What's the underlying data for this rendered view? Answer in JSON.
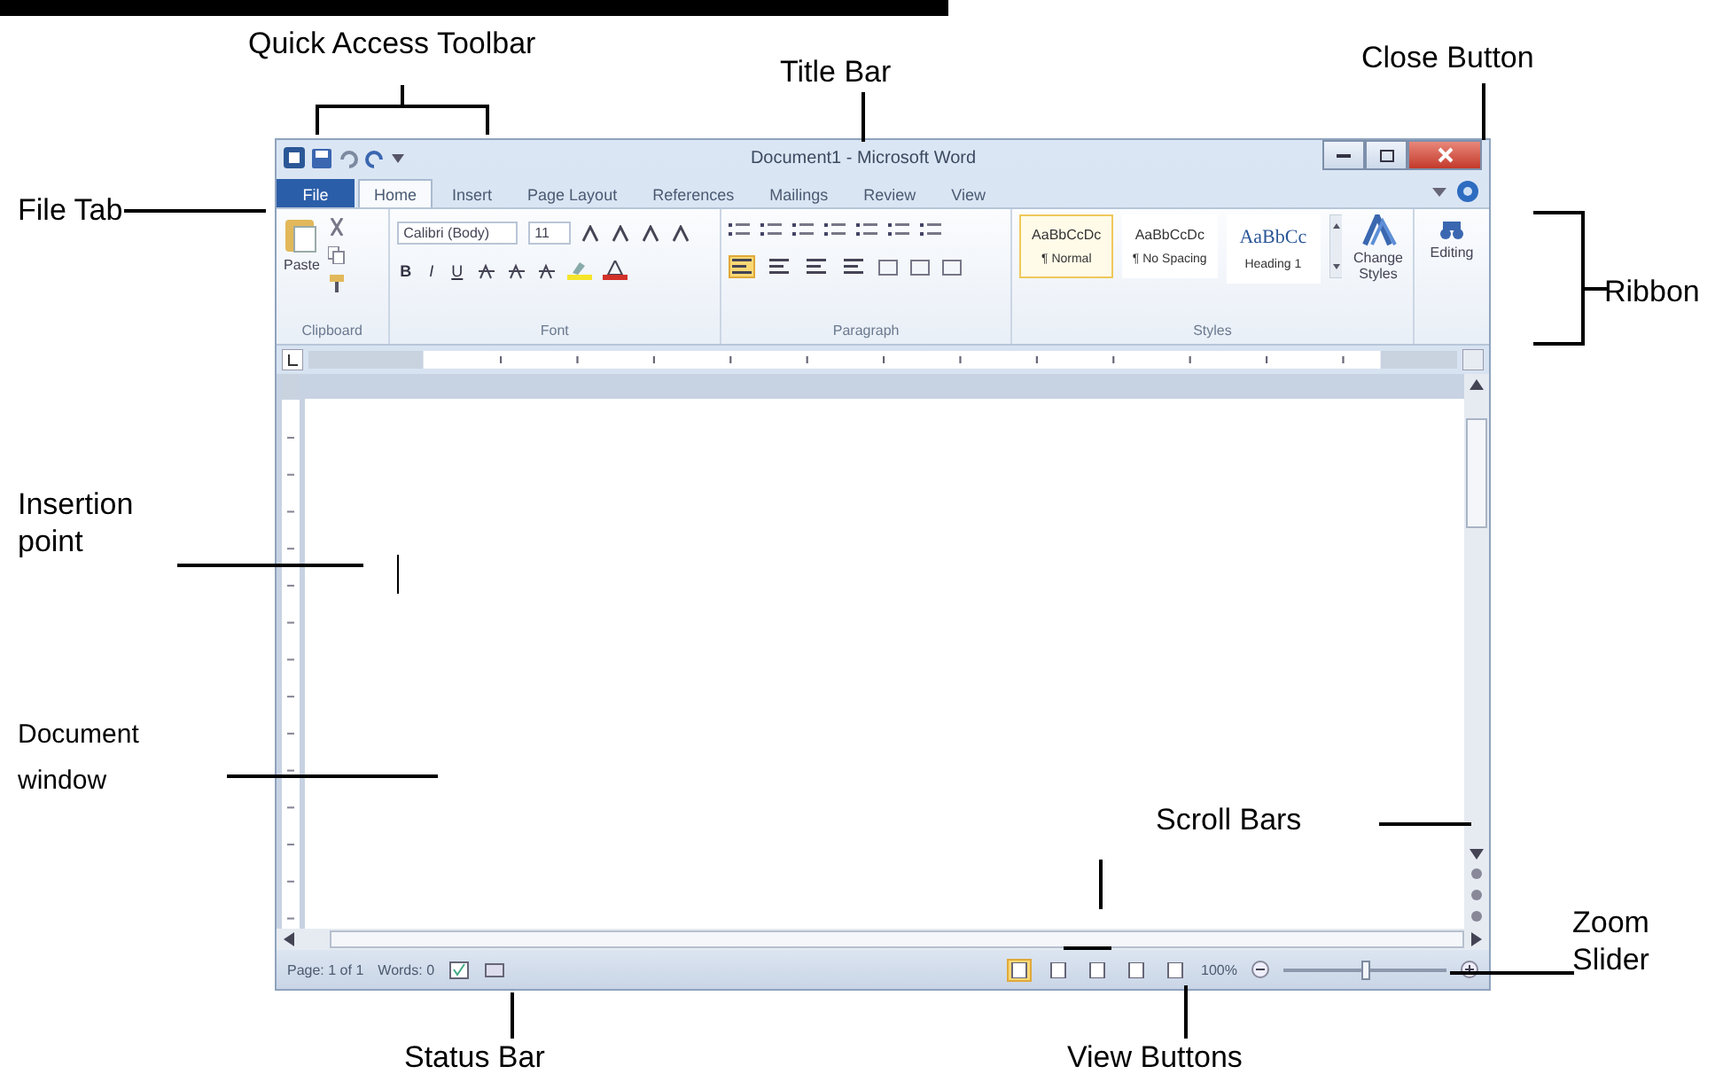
{
  "callouts": [
    {
      "label": "Quick Access Toolbar"
    },
    {
      "label": "Title Bar"
    },
    {
      "label": "Close Button"
    },
    {
      "label": "File Tab"
    },
    {
      "label": "Ribbon"
    },
    {
      "label": "Insertion point"
    },
    {
      "label": "Document window"
    },
    {
      "label": "Scroll Bars"
    },
    {
      "label": "Zoom Slider"
    },
    {
      "label": "Status Bar"
    },
    {
      "label": "View Buttons"
    }
  ],
  "window": {
    "title": "Document1 - Microsoft Word",
    "tabs": [
      {
        "label": "File",
        "kind": "file",
        "selected": false
      },
      {
        "label": "Home",
        "kind": "tab",
        "selected": true
      },
      {
        "label": "Insert",
        "kind": "tab",
        "selected": false
      },
      {
        "label": "Page Layout",
        "kind": "tab",
        "selected": false
      },
      {
        "label": "References",
        "kind": "tab",
        "selected": false
      },
      {
        "label": "Mailings",
        "kind": "tab",
        "selected": false
      },
      {
        "label": "Review",
        "kind": "tab",
        "selected": false
      },
      {
        "label": "View",
        "kind": "tab",
        "selected": false
      }
    ],
    "ribbon": {
      "paste": "Paste",
      "font_name": "Calibri (Body)",
      "font_size": "11",
      "format_buttons": [
        "B",
        "I",
        "U"
      ],
      "alignment": [
        {
          "selected": true
        },
        {
          "selected": false
        },
        {
          "selected": false
        },
        {
          "selected": false
        }
      ],
      "styles": [
        {
          "preview": "AaBbCcDc",
          "name": "¶ Normal",
          "selected": true
        },
        {
          "preview": "AaBbCcDc",
          "name": "¶ No Spacing",
          "selected": false
        },
        {
          "preview": "AaBbCc",
          "name": "Heading 1",
          "selected": false
        }
      ],
      "change_styles": "Change Styles",
      "editing": "Editing",
      "groups": [
        "Clipboard",
        "Font",
        "Paragraph",
        "Styles"
      ]
    },
    "status_bar": {
      "page": "Page: 1 of 1",
      "words": "Words: 0",
      "view_buttons": [
        {
          "selected": true
        },
        {
          "selected": false
        },
        {
          "selected": false
        },
        {
          "selected": false
        },
        {
          "selected": false
        }
      ],
      "zoom": "100%",
      "zoom_slider": {
        "level": 0.5
      }
    }
  }
}
